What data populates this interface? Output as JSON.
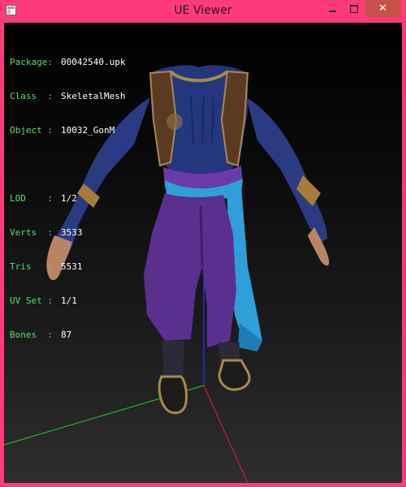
{
  "window": {
    "title": "UE Viewer",
    "icon": "app-icon",
    "controls": [
      "minimize-icon",
      "maximize-icon",
      "close-icon"
    ],
    "close_color": "#c7504a",
    "frame_color": "#ff3a7c"
  },
  "info": {
    "package": {
      "label": "Package:",
      "value": "00042540.upk"
    },
    "class": {
      "label": "Class  :",
      "value": "SkeletalMesh"
    },
    "object": {
      "label": "Object :",
      "value": "10032_GonM"
    },
    "lod": {
      "label": "LOD    :",
      "value": "1/2"
    },
    "verts": {
      "label": "Verts  :",
      "value": "3533"
    },
    "tris": {
      "label": "Tris   :",
      "value": "5531"
    },
    "uvset": {
      "label": "UV Set :",
      "value": "1/1"
    },
    "bones": {
      "label": "Bones  :",
      "value": "87"
    },
    "label_color": "#57e06a",
    "value_color": "#ffffff"
  },
  "axes": {
    "x_color": "#e0203a",
    "y_color": "#20d020",
    "z_color": "#2030e0"
  }
}
